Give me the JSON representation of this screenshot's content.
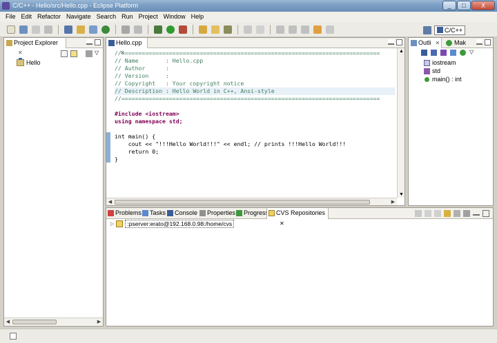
{
  "window": {
    "title": "C/C++ - Hello/src/Hello.cpp - Eclipse Platform",
    "controls": [
      "_",
      "□",
      "X"
    ]
  },
  "menu": [
    "File",
    "Edit",
    "Refactor",
    "Navigate",
    "Search",
    "Run",
    "Project",
    "Window",
    "Help"
  ],
  "perspective": {
    "label": "C/C++"
  },
  "project_explorer": {
    "tab_label": "Project Explorer",
    "items": [
      {
        "label": "Hello"
      }
    ]
  },
  "editor": {
    "tab_label": "Hello.cpp",
    "lines": [
      "//============================================================================",
      "// Name        : Hello.cpp",
      "// Author      :",
      "// Version     :",
      "// Copyright   : Your copyright notice",
      "// Description : Hello World in C++, Ansi-style",
      "//============================================================================",
      "",
      "#include <iostream>",
      "using namespace std;",
      "",
      "int main() {",
      "    cout << \"!!!Hello World!!!\" << endl; // prints !!!Hello World!!!",
      "    return 0;",
      "}"
    ]
  },
  "outline": {
    "tab_label": "Outli",
    "tab2_label": "Mak",
    "items": [
      {
        "label": "iostream",
        "icon": "include-icon"
      },
      {
        "label": "std",
        "icon": "namespace-icon"
      },
      {
        "label": "main() : int",
        "icon": "function-icon"
      }
    ]
  },
  "bottom_panel": {
    "tabs": [
      {
        "label": "Problems",
        "icon": "problems-icon"
      },
      {
        "label": "Tasks",
        "icon": "tasks-icon"
      },
      {
        "label": "Console",
        "icon": "console-icon"
      },
      {
        "label": "Properties",
        "icon": "properties-icon"
      },
      {
        "label": "Progress",
        "icon": "progress-icon"
      },
      {
        "label": "CVS Repositories",
        "icon": "cvs-icon",
        "active": true
      }
    ],
    "repository": ":pserver:erato@192.168.0.98:/home/cvs"
  },
  "colors": {
    "comment": "#3f7f5f",
    "keyword": "#7f0055",
    "string": "#2a00ff",
    "titlebar": "#7b9ec4"
  }
}
